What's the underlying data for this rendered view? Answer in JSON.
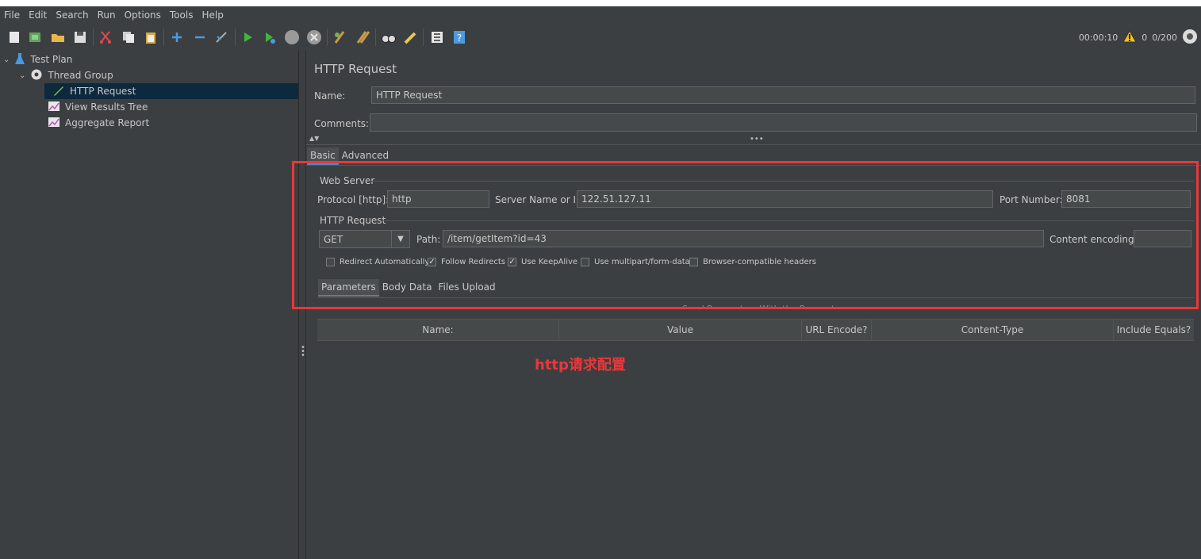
{
  "menu": [
    "File",
    "Edit",
    "Search",
    "Run",
    "Options",
    "Tools",
    "Help"
  ],
  "status": {
    "timer": "00:00:10",
    "warnings": "0",
    "threads": "0/200"
  },
  "tree": [
    {
      "label": "Test Plan",
      "icon": "flask-icon"
    },
    {
      "label": "Thread Group",
      "icon": "gear-icon"
    },
    {
      "label": "HTTP Request",
      "icon": "pencil-icon"
    },
    {
      "label": "View Results Tree",
      "icon": "chart-icon"
    },
    {
      "label": "Aggregate Report",
      "icon": "chart-icon"
    }
  ],
  "panel": {
    "title": "HTTP Request",
    "name_label": "Name:",
    "name_value": "HTTP Request",
    "comments_label": "Comments:",
    "comments_value": "",
    "tabs": [
      "Basic",
      "Advanced"
    ],
    "web_server": {
      "group": "Web Server",
      "protocol_label": "Protocol [http]:",
      "protocol_value": "http",
      "server_label": "Server Name or IP:",
      "server_value": "122.51.127.11",
      "port_label": "Port Number:",
      "port_value": "8081"
    },
    "http_request": {
      "group": "HTTP Request",
      "method": "GET",
      "path_label": "Path:",
      "path_value": "/item/getItem?id=43",
      "encoding_label": "Content encoding:",
      "encoding_value": ""
    },
    "checkboxes": [
      {
        "label": "Redirect Automatically",
        "checked": false
      },
      {
        "label": "Follow Redirects",
        "checked": true
      },
      {
        "label": "Use KeepAlive",
        "checked": true
      },
      {
        "label": "Use multipart/form-data",
        "checked": false
      },
      {
        "label": "Browser-compatible headers",
        "checked": false
      }
    ],
    "subtabs": [
      "Parameters",
      "Body Data",
      "Files Upload"
    ],
    "ghost_caption": "Send Parameters With the Request:",
    "table_headers": [
      "Name:",
      "Value",
      "URL Encode?",
      "Content-Type",
      "Include Equals?"
    ]
  },
  "annotation": "http请求配置",
  "colors": {
    "annotation": "#e8383a",
    "selection": "#0d293e",
    "background": "#3c3f41"
  }
}
